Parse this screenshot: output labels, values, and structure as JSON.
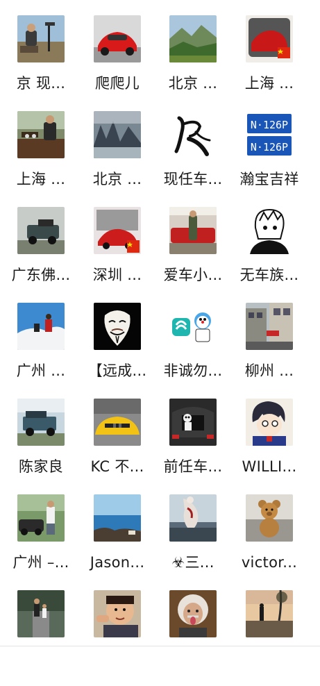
{
  "members": [
    {
      "name": "京 现...",
      "avatar": "man-outdoor-telescope"
    },
    {
      "name": "爬爬儿",
      "avatar": "red-ferrari"
    },
    {
      "name": "北京 ...",
      "avatar": "mountain-landscape"
    },
    {
      "name": "上海 ...",
      "avatar": "red-car-china-flag"
    },
    {
      "name": "上海 ...",
      "avatar": "man-tea-table"
    },
    {
      "name": "北京 ...",
      "avatar": "foggy-mountains"
    },
    {
      "name": "现任车...",
      "avatar": "calligraphy-character"
    },
    {
      "name": "瀚宝吉祥",
      "avatar": "license-plate"
    },
    {
      "name": "广东佛...",
      "avatar": "offroad-truck"
    },
    {
      "name": "深圳 ...",
      "avatar": "red-sportscar-china-flag"
    },
    {
      "name": "爱车小...",
      "avatar": "man-car-showroom"
    },
    {
      "name": "无车族...",
      "avatar": "anime-sketch-boy"
    },
    {
      "name": "广州 ...",
      "avatar": "snowy-mountain-people"
    },
    {
      "name": "【远成...",
      "avatar": "anonymous-mask"
    },
    {
      "name": "非诚勿...",
      "avatar": "app-logo-doraemon"
    },
    {
      "name": "柳州 ...",
      "avatar": "street-buildings"
    },
    {
      "name": "陈家良",
      "avatar": "land-rover"
    },
    {
      "name": "KC  不...",
      "avatar": "yellow-bmw"
    },
    {
      "name": "前任车...",
      "avatar": "car-trunk-doll"
    },
    {
      "name": "WILLI...",
      "avatar": "anime-detective"
    },
    {
      "name": "广州 –...",
      "avatar": "man-vintage-car"
    },
    {
      "name": "Jason...",
      "avatar": "seaside-rocks"
    },
    {
      "name": "☣三...",
      "avatar": "figure-on-rocks"
    },
    {
      "name": "victor...",
      "avatar": "teddy-bear"
    },
    {
      "name": "",
      "avatar": "people-walking-street"
    },
    {
      "name": "",
      "avatar": "kid-pointing"
    },
    {
      "name": "",
      "avatar": "einstein-tongue"
    },
    {
      "name": "",
      "avatar": "sunset-runner"
    }
  ],
  "colors": {
    "text": "#1a1a1a",
    "background": "#ffffff",
    "divider": "#e2e2e2"
  }
}
